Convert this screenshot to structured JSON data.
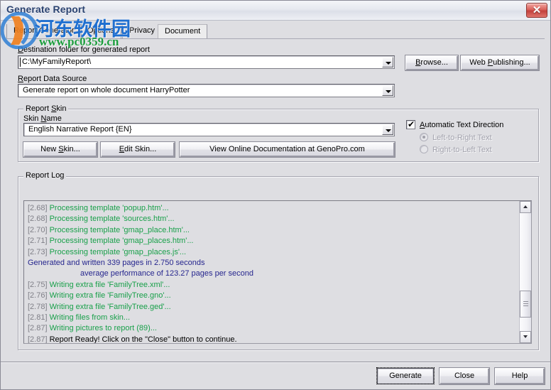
{
  "window": {
    "title": "Generate Report",
    "close_icon": "close-icon"
  },
  "watermark": {
    "chinese": "河东软件园",
    "url": "www.pc0359.cn"
  },
  "tabs": [
    {
      "label": "Report Generator",
      "selected": false
    },
    {
      "label": "Options",
      "selected": false
    },
    {
      "label": "Privacy",
      "selected": false
    },
    {
      "label": "Document",
      "selected": true
    }
  ],
  "destination": {
    "label_pre": "",
    "label_u": "D",
    "label_post": "estination folder for generated report",
    "value": "C:\\MyFamilyReport\\",
    "dropdown_icon": "chevron-down-icon"
  },
  "data_source": {
    "label_pre": "",
    "label_u": "R",
    "label_post": "eport Data Source",
    "value": "Generate report on whole document HarryPotter",
    "dropdown_icon": "chevron-down-icon"
  },
  "report_skin": {
    "group_pre": "Report ",
    "group_u": "S",
    "group_post": "kin",
    "skin_label_pre": "Skin ",
    "skin_label_u": "N",
    "skin_label_post": "ame",
    "skin_value": "English Narrative Report  {EN}",
    "dropdown_icon": "chevron-down-icon",
    "new_skin_pre": "New ",
    "new_skin_u": "S",
    "new_skin_post": "kin...",
    "edit_skin_pre": "",
    "edit_skin_u": "E",
    "edit_skin_post": "dit Skin...",
    "view_docs": "View Online Documentation at GenoPro.com"
  },
  "text_direction": {
    "auto_pre": "",
    "auto_u": "A",
    "auto_post": "utomatic Text Direction",
    "auto_checked": true,
    "check_icon": "checkmark-icon",
    "ltr": "Left-to-Right Text",
    "rtl": "Right-to-Left Text",
    "selected": "ltr",
    "disabled": true
  },
  "toolbar": {
    "browse_pre": "",
    "browse_u": "B",
    "browse_post": "rowse...",
    "webpub_pre": "Web ",
    "webpub_u": "P",
    "webpub_post": "ublishing..."
  },
  "report_log": {
    "group_caption": "Report Log",
    "scrollbar": {
      "up_icon": "chevron-up-icon",
      "down_icon": "chevron-down-icon",
      "thumb_position_pct": 78
    },
    "lines": [
      {
        "ts": "[2.68]",
        "text": "Processing template 'popup.htm'...",
        "color": "green",
        "indent": false
      },
      {
        "ts": "[2.68]",
        "text": "Processing template 'sources.htm'...",
        "color": "green",
        "indent": false
      },
      {
        "ts": "[2.70]",
        "text": "Processing template 'gmap_place.htm'...",
        "color": "green",
        "indent": false
      },
      {
        "ts": "[2.71]",
        "text": "Processing template 'gmap_places.htm'...",
        "color": "green",
        "indent": false
      },
      {
        "ts": "[2.73]",
        "text": "Processing template 'gmap_places.js'...",
        "color": "green",
        "indent": false
      },
      {
        "ts": "",
        "text": "Generated and written 339 pages in 2.750 seconds",
        "color": "blue",
        "indent": false
      },
      {
        "ts": "",
        "text": "average performance of 123.27 pages per second",
        "color": "blue",
        "indent": true
      },
      {
        "ts": "[2.75]",
        "text": "Writing extra file 'FamilyTree.xml'...",
        "color": "green",
        "indent": false
      },
      {
        "ts": "[2.76]",
        "text": "Writing extra file 'FamilyTree.gno'...",
        "color": "green",
        "indent": false
      },
      {
        "ts": "[2.78]",
        "text": "Writing extra file 'FamilyTree.ged'...",
        "color": "green",
        "indent": false
      },
      {
        "ts": "[2.81]",
        "text": "Writing files from skin...",
        "color": "green",
        "indent": false
      },
      {
        "ts": "[2.87]",
        "text": "Writing pictures to report (89)...",
        "color": "green",
        "indent": false
      },
      {
        "ts": "[2.87]",
        "text": "Report Ready!  Click on the \"Close\" button to continue.",
        "color": "black",
        "indent": false
      }
    ]
  },
  "footer": {
    "generate": "Generate",
    "close": "Close",
    "help": "Help"
  },
  "colors": {
    "dialog_bg": "#dedee2",
    "log_green": "#19a04a",
    "log_blue": "#26268e",
    "title_text": "#2a4270",
    "close_red": "#c2403c"
  }
}
